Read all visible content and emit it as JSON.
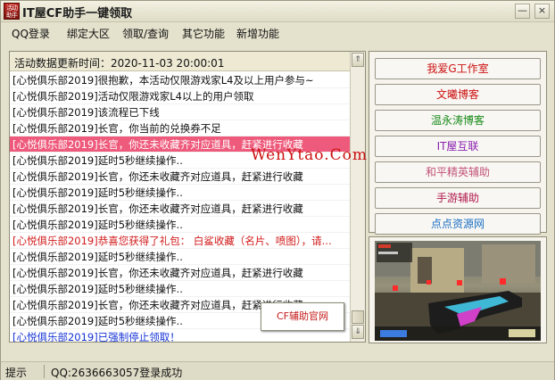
{
  "window": {
    "title": "IT屋CF助手一键领取",
    "icon_text": "活动助手",
    "minimize_glyph": "—",
    "close_glyph": "×"
  },
  "menu": [
    "QQ登录",
    "绑定大区",
    "领取/查询",
    "其它功能",
    "新增功能"
  ],
  "log": {
    "header": "活动数据更新时间：2020-11-03 20:00:01",
    "rows": [
      {
        "text": "[心悦俱乐部2019]很抱歉，本活动仅限游戏家L4及以上用户参与~",
        "style": ""
      },
      {
        "text": "[心悦俱乐部2019]活动仅限游戏家L4以上的用户领取",
        "style": ""
      },
      {
        "text": "[心悦俱乐部2019]该流程已下线",
        "style": ""
      },
      {
        "text": "[心悦俱乐部2019]长官，你当前的兑换券不足",
        "style": ""
      },
      {
        "text": "[心悦俱乐部2019]长官，你还未收藏齐对应道具，赶紧进行收藏",
        "style": "sel"
      },
      {
        "text": "[心悦俱乐部2019]延时5秒继续操作..",
        "style": ""
      },
      {
        "text": "[心悦俱乐部2019]长官，你还未收藏齐对应道具，赶紧进行收藏",
        "style": ""
      },
      {
        "text": "[心悦俱乐部2019]延时5秒继续操作..",
        "style": ""
      },
      {
        "text": "[心悦俱乐部2019]长官，你还未收藏齐对应道具，赶紧进行收藏",
        "style": ""
      },
      {
        "text": "[心悦俱乐部2019]延时5秒继续操作..",
        "style": ""
      },
      {
        "text": "[心悦俱乐部2019]恭喜您获得了礼包： 白鲨收藏（名片、喷图），请...",
        "style": "red"
      },
      {
        "text": "[心悦俱乐部2019]延时5秒继续操作..",
        "style": ""
      },
      {
        "text": "[心悦俱乐部2019]长官，你还未收藏齐对应道具，赶紧进行收藏",
        "style": ""
      },
      {
        "text": "[心悦俱乐部2019]延时5秒继续操作..",
        "style": ""
      },
      {
        "text": "[心悦俱乐部2019]长官，你还未收藏齐对应道具，赶紧进行收藏",
        "style": ""
      },
      {
        "text": "[心悦俱乐部2019]延时5秒继续操作..",
        "style": ""
      },
      {
        "text": "[心悦俱乐部2019]已强制停止领取！",
        "style": "blue"
      }
    ]
  },
  "popup": {
    "label": "CF辅助官网"
  },
  "watermark": "WenYtao.Com",
  "links": [
    {
      "label": "我爱G工作室",
      "color": "#cc1111"
    },
    {
      "label": "文曦博客",
      "color": "#cc1111"
    },
    {
      "label": "温永涛博客",
      "color": "#178a17"
    },
    {
      "label": "IT屋互联",
      "color": "#8a1fb0"
    },
    {
      "label": "和平精英辅助",
      "color": "#c2547a"
    },
    {
      "label": "手游辅助",
      "color": "#b0184e"
    },
    {
      "label": "点点资源网",
      "color": "#1a6fc4"
    }
  ],
  "status": {
    "label": "提示",
    "text": "QQ:2636663057登录成功"
  },
  "icons": {
    "scroll_up": "⇑",
    "scroll_down": "⇓"
  }
}
